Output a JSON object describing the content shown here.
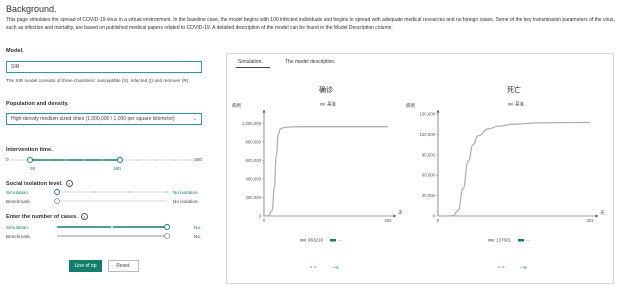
{
  "header": {
    "title": "Background.",
    "description": "This page simulates the spread of COVID-19 virus in a virtual environment. In the baseline case, the model begins with 100 infected individuals and begins to spread with adequate medical resources and no foreign cases. Some of the key transmission parameters of the virus, such as infection and mortality, are based on published medical papers related to COVID-19. A detailed description of the model can be found in the Model Description column."
  },
  "model": {
    "label": "Model.",
    "value": "SIR",
    "note": "The SIR model consists of three chambers: susceptible (S), infected (I) and remover (R)."
  },
  "population": {
    "label": "Population and density.",
    "value": "High-density medium-sized cities (1,000,000 / 1,000 per square kilometre)"
  },
  "intervention": {
    "label": "Intervention time.",
    "min": "0",
    "max": "300",
    "tick_low": "30",
    "tick_high": "180",
    "range": [
      30,
      180
    ],
    "scale": [
      0,
      300
    ]
  },
  "isolation": {
    "label": "Social isolation level.",
    "simulation_label": "Simulation.",
    "benchmark_label": "Benchmark.",
    "simulation_value": "No isolation.",
    "benchmark_value": "No isolation."
  },
  "cases": {
    "label": "Enter the number of cases.",
    "simulation_label": "Simulation.",
    "benchmark_label": "Benchmark.",
    "simulation_value": "No.",
    "benchmark_value": "No."
  },
  "buttons": {
    "primary": "Line of op",
    "reset": "Reset."
  },
  "tabs": [
    "Simulation.",
    "The model description."
  ],
  "legend_bottom": {
    "sim_symbol": "- -",
    "suffix": "--%"
  },
  "colors": {
    "accent": "#11806a",
    "baseline": "#b0b0b0",
    "border": "#2a9d8f"
  },
  "chart_data": [
    {
      "type": "line",
      "title": "确诊",
      "ylabel": "病例",
      "xlabel": "天",
      "legend": "基准",
      "xlim": [
        0,
        303
      ],
      "ylim": [
        0,
        1100000
      ],
      "yticks": [
        "0",
        "200,000",
        "400,000",
        "600,000",
        "800,000",
        "1,000,000"
      ],
      "xticks": [
        "0",
        "303"
      ],
      "series": [
        {
          "name": "基准",
          "x": [
            0,
            10,
            20,
            25,
            30,
            35,
            40,
            50,
            60,
            80,
            100,
            150,
            200,
            303
          ],
          "values": [
            0,
            1000,
            60000,
            300000,
            650000,
            880000,
            940000,
            955000,
            960000,
            962000,
            963000,
            963200,
            963210,
            963210
          ]
        }
      ],
      "total_label": "963210"
    },
    {
      "type": "line",
      "title": "死亡",
      "ylabel": "病例",
      "xlabel": "天",
      "legend": "基准",
      "xlim": [
        0,
        303
      ],
      "ylim": [
        0,
        150000
      ],
      "yticks": [
        "0",
        "30,000",
        "60,000",
        "90,000",
        "120,000",
        "150,000"
      ],
      "xticks": [
        "0",
        "303"
      ],
      "series": [
        {
          "name": "基准",
          "x": [
            0,
            20,
            30,
            40,
            50,
            60,
            70,
            80,
            100,
            120,
            150,
            200,
            303
          ],
          "values": [
            0,
            0,
            500,
            8000,
            40000,
            80000,
            105000,
            118000,
            128000,
            132000,
            135000,
            137000,
            137601
          ]
        }
      ],
      "total_label": "137601"
    }
  ]
}
